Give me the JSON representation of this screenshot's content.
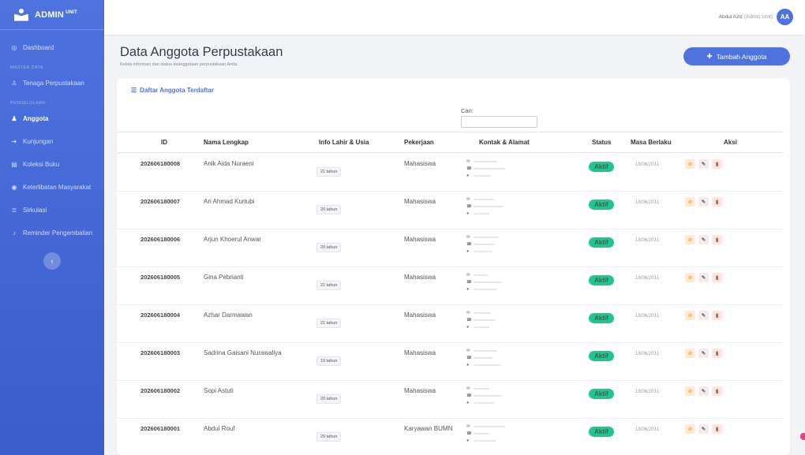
{
  "brand": {
    "name": "ADMIN",
    "badge": "UNIT"
  },
  "sidebar": {
    "items": [
      {
        "type": "link",
        "label": "Dashboard",
        "icon": "dashboard-icon",
        "active": false
      },
      {
        "type": "heading",
        "label": "MASTER DATA"
      },
      {
        "type": "link",
        "label": "Tenaga Perpustakaan",
        "icon": "user-icon",
        "active": false
      },
      {
        "type": "heading",
        "label": "PENGELOLAAN"
      },
      {
        "type": "link",
        "label": "Anggota",
        "icon": "users-icon",
        "active": true
      },
      {
        "type": "link",
        "label": "Kunjungan",
        "icon": "visit-icon",
        "active": false
      },
      {
        "type": "link",
        "label": "Koleksi Buku",
        "icon": "book-icon",
        "active": false
      },
      {
        "type": "link",
        "label": "Keterlibatan Masyarakat",
        "icon": "eye-icon",
        "active": false
      },
      {
        "type": "link",
        "label": "Sirkulasi",
        "icon": "circulation-icon",
        "active": false
      },
      {
        "type": "link",
        "label": "Reminder Pengembalian",
        "icon": "bell-icon",
        "active": false
      }
    ]
  },
  "topbar": {
    "user_name": "Abdul Aziz",
    "user_role": "(Admin Unit)",
    "avatar_initials": "AA"
  },
  "page": {
    "title": "Data Anggota Perpustakaan",
    "subtitle": "Kelola informasi dan status keanggotaan perpustakaan Anda.",
    "add_button": "Tambah Anggota"
  },
  "card": {
    "title": "Daftar Anggota Terdaftar",
    "search_label": "Cari:"
  },
  "table": {
    "columns": [
      "ID",
      "Nama Lengkap",
      "Info Lahir & Usia",
      "Pekerjaan",
      "Kontak & Alamat",
      "Status",
      "Masa Berlaku",
      "Aksi"
    ],
    "rows": [
      {
        "id": "202606180008",
        "name": "Anik Aida Nuraeni",
        "age": "21 tahun",
        "job": "Mahasiswa",
        "status": "Aktif",
        "expiry": "18/06/2031"
      },
      {
        "id": "202606180007",
        "name": "Ari Ahmad Kurtubi",
        "age": "20 tahun",
        "job": "Mahasiswa",
        "status": "Aktif",
        "expiry": "18/06/2031"
      },
      {
        "id": "202606180006",
        "name": "Arjun Khoerul Anwar",
        "age": "20 tahun",
        "job": "Mahasiswa",
        "status": "Aktif",
        "expiry": "18/06/2031"
      },
      {
        "id": "202606180005",
        "name": "Gina Pebrianti",
        "age": "21 tahun",
        "job": "Mahasiswa",
        "status": "Aktif",
        "expiry": "18/06/2031"
      },
      {
        "id": "202606180004",
        "name": "Azhar Darmawan",
        "age": "21 tahun",
        "job": "Mahasiswa",
        "status": "Aktif",
        "expiry": "18/06/2031"
      },
      {
        "id": "202606180003",
        "name": "Sadrina Gaisani Nurawaliya",
        "age": "19 tahun",
        "job": "Mahasiswa",
        "status": "Aktif",
        "expiry": "18/06/2031"
      },
      {
        "id": "202606180002",
        "name": "Sopi Astuti",
        "age": "20 tahun",
        "job": "Mahasiswa",
        "status": "Aktif",
        "expiry": "18/06/2031"
      },
      {
        "id": "202606180001",
        "name": "Abdul Rouf",
        "age": "29 tahun",
        "job": "Karyawan BUMN",
        "status": "Aktif",
        "expiry": "18/06/2031"
      }
    ]
  },
  "colors": {
    "primary": "#4e73df",
    "success": "#1cc88a",
    "danger": "#e74a3b",
    "warning": "#f6b400"
  }
}
